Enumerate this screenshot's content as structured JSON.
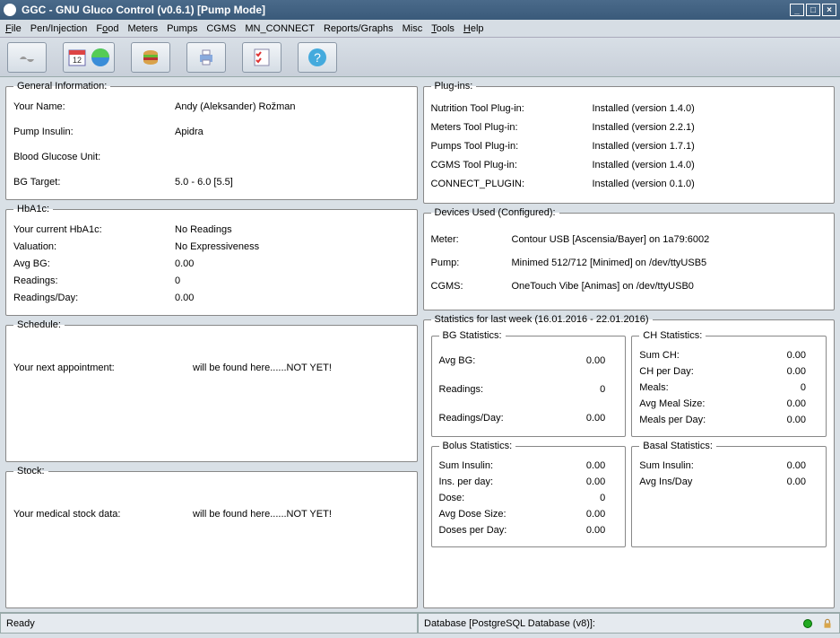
{
  "window": {
    "title": "GGC - GNU Gluco Control (v0.6.1) [Pump Mode]"
  },
  "menu": {
    "file": "File",
    "pen": "Pen/Injection",
    "food": "Food",
    "meters": "Meters",
    "pumps": "Pumps",
    "cgms": "CGMS",
    "mnconnect": "MN_CONNECT",
    "reports": "Reports/Graphs",
    "misc": "Misc",
    "tools": "Tools",
    "help": "Help"
  },
  "general": {
    "title": "General Information:",
    "name_label": "Your Name:",
    "name": "Andy (Aleksander) Rožman",
    "insulin_label": "Pump Insulin:",
    "insulin": "Apidra",
    "bgu_label": "Blood Glucose Unit:",
    "bgu": "",
    "target_label": "BG Target:",
    "target": "5.0 - 6.0 [5.5]"
  },
  "hba1c": {
    "title": "HbA1c:",
    "current_label": "Your current HbA1c:",
    "current": "No Readings",
    "valuation_label": "Valuation:",
    "valuation": "No Expressiveness",
    "avgbg_label": "Avg BG:",
    "avgbg": "0.00",
    "readings_label": "Readings:",
    "readings": "0",
    "rpd_label": "Readings/Day:",
    "rpd": "0.00"
  },
  "schedule": {
    "title": "Schedule:",
    "label": "Your next appointment:",
    "value": "will be found here......NOT YET!"
  },
  "stock": {
    "title": "Stock:",
    "label": "Your medical stock data:",
    "value": "will be found here......NOT YET!"
  },
  "plugins": {
    "title": "Plug-ins:",
    "items": [
      {
        "name": "Nutrition Tool Plug-in:",
        "status": "Installed (version 1.4.0)"
      },
      {
        "name": "Meters Tool Plug-in:",
        "status": "Installed (version 2.2.1)"
      },
      {
        "name": "Pumps Tool Plug-in:",
        "status": "Installed (version 1.7.1)"
      },
      {
        "name": "CGMS Tool Plug-in:",
        "status": "Installed (version 1.4.0)"
      },
      {
        "name": "CONNECT_PLUGIN:",
        "status": "Installed (version 0.1.0)"
      }
    ]
  },
  "devices": {
    "title": "Devices Used (Configured):",
    "items": [
      {
        "kind": "Meter:",
        "desc": "Contour USB [Ascensia/Bayer] on 1a79:6002"
      },
      {
        "kind": "Pump:",
        "desc": "Minimed 512/712 [Minimed] on /dev/ttyUSB5"
      },
      {
        "kind": "CGMS:",
        "desc": "OneTouch Vibe [Animas] on /dev/ttyUSB0"
      }
    ]
  },
  "stats": {
    "title": "Statistics for last week (16.01.2016 - 22.01.2016)",
    "bg": {
      "title": "BG Statistics:",
      "avgbg_label": "Avg BG:",
      "avgbg": "0.00",
      "readings_label": "Readings:",
      "readings": "0",
      "rpd_label": "Readings/Day:",
      "rpd": "0.00"
    },
    "ch": {
      "title": "CH Statistics:",
      "sum_label": "Sum CH:",
      "sum": "0.00",
      "perday_label": "CH per Day:",
      "perday": "0.00",
      "meals_label": "Meals:",
      "meals": "0",
      "avgmeal_label": "Avg Meal Size:",
      "avgmeal": "0.00",
      "mpd_label": "Meals per Day:",
      "mpd": "0.00"
    },
    "bolus": {
      "title": "Bolus Statistics:",
      "sum_label": "Sum Insulin:",
      "sum": "0.00",
      "perday_label": "Ins. per day:",
      "perday": "0.00",
      "dose_label": "Dose:",
      "dose": "0",
      "avgdose_label": "Avg Dose Size:",
      "avgdose": "0.00",
      "dpd_label": "Doses per Day:",
      "dpd": "0.00"
    },
    "basal": {
      "title": "Basal Statistics:",
      "sum_label": "Sum Insulin:",
      "sum": "0.00",
      "avg_label": "Avg Ins/Day",
      "avg": "0.00"
    }
  },
  "status": {
    "left": "Ready",
    "right": "Database [PostgreSQL Database (v8)]:"
  }
}
